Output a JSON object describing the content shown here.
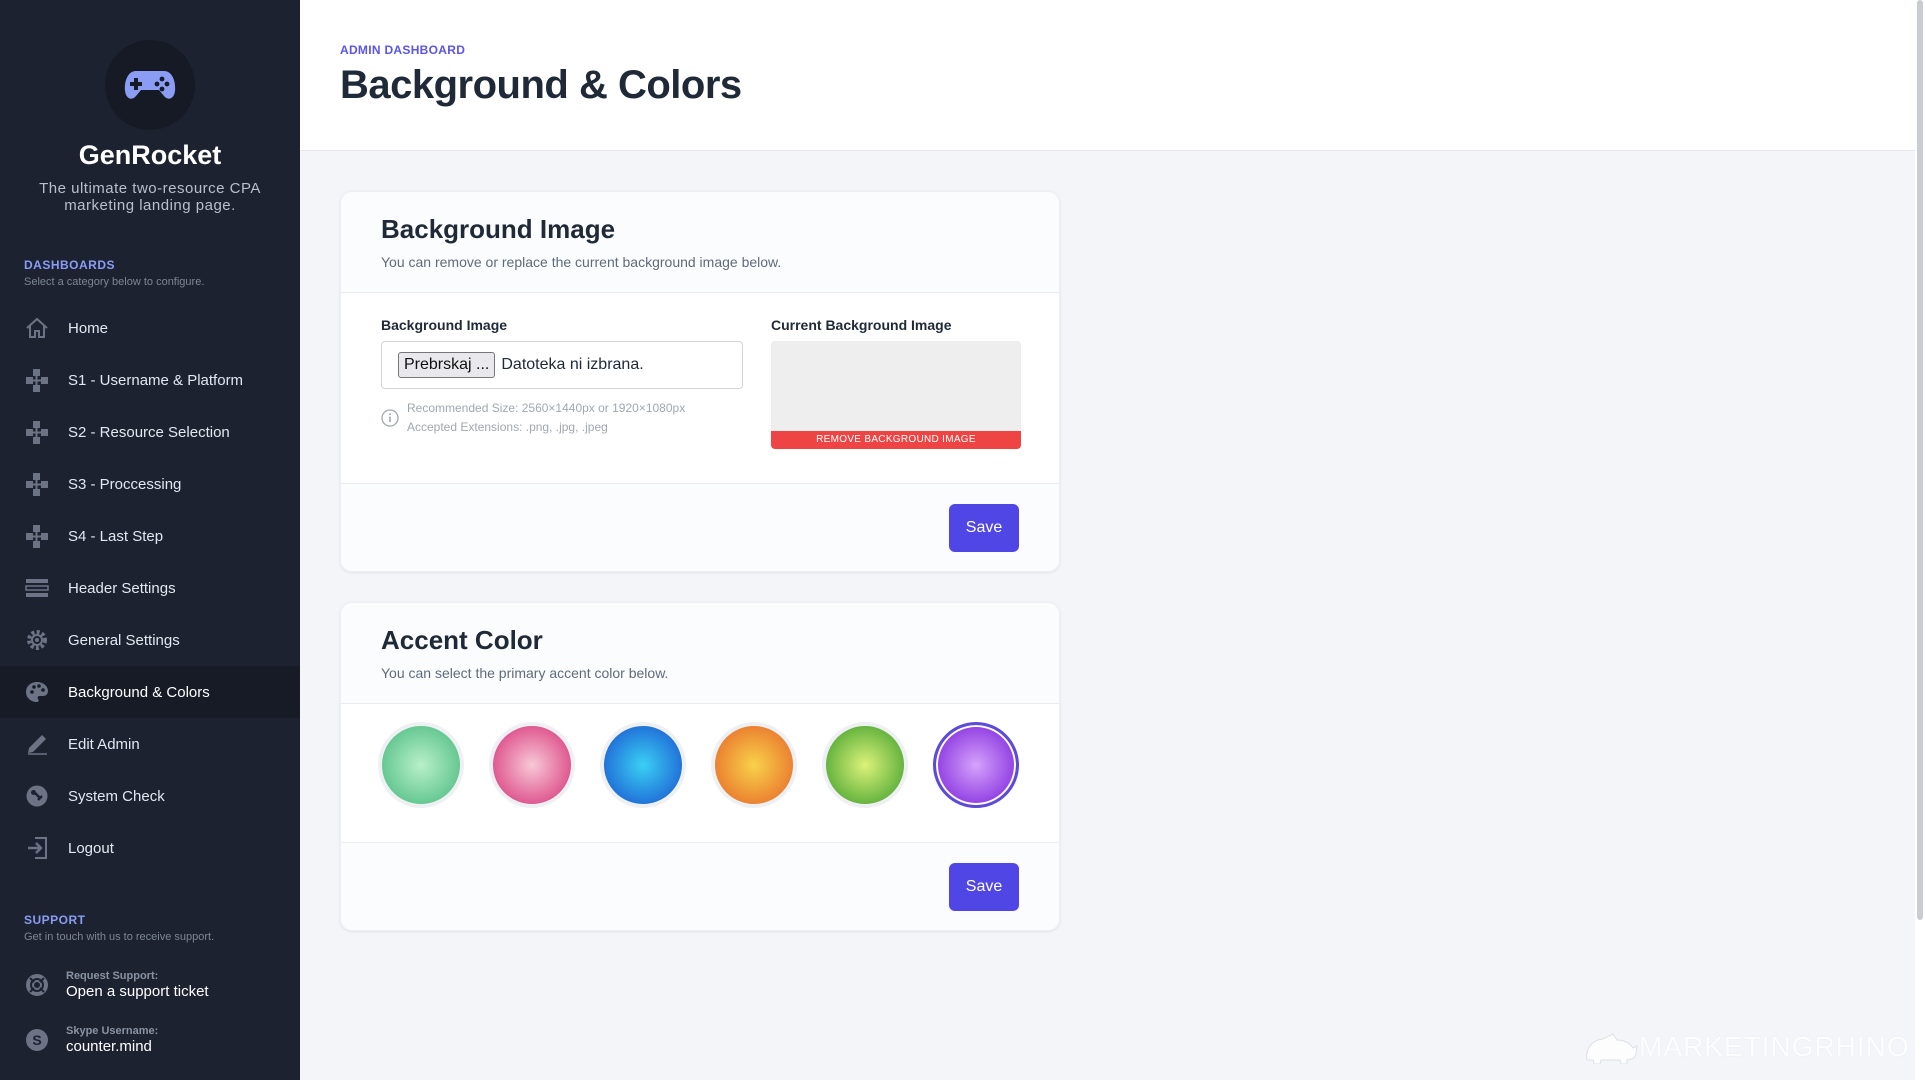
{
  "sidebar": {
    "brand": "GenRocket",
    "tagline": "The ultimate two-resource CPA marketing landing page.",
    "dashboards_title": "DASHBOARDS",
    "dashboards_sub": "Select a category below to configure.",
    "items": [
      {
        "label": "Home",
        "icon": "home-icon"
      },
      {
        "label": "S1 - Username & Platform",
        "icon": "nodes-icon"
      },
      {
        "label": "S2 - Resource Selection",
        "icon": "nodes-icon"
      },
      {
        "label": "S3 - Proccessing",
        "icon": "nodes-icon"
      },
      {
        "label": "S4 - Last Step",
        "icon": "nodes-icon"
      },
      {
        "label": "Header Settings",
        "icon": "header-icon"
      },
      {
        "label": "General Settings",
        "icon": "gear-icon"
      },
      {
        "label": "Background & Colors",
        "icon": "palette-icon",
        "active": true
      },
      {
        "label": "Edit Admin",
        "icon": "pencil-icon"
      },
      {
        "label": "System Check",
        "icon": "wrench-icon"
      },
      {
        "label": "Logout",
        "icon": "logout-icon"
      }
    ],
    "support_title": "SUPPORT",
    "support_sub": "Get in touch with us to receive support.",
    "support_ticket_small": "Request Support:",
    "support_ticket_big": "Open a support ticket",
    "skype_small": "Skype Username:",
    "skype_big": "counter.mind"
  },
  "header": {
    "breadcrumb": "ADMIN DASHBOARD",
    "title": "Background & Colors"
  },
  "background_card": {
    "title": "Background Image",
    "subtitle": "You can remove or replace the current background image below.",
    "field_label": "Background Image",
    "file_button": "Prebrskaj ...",
    "file_status": "Datoteka ni izbrana.",
    "hint_line1": "Recommended Size: 2560×1440px or 1920×1080px",
    "hint_line2": "Accepted Extensions: .png, .jpg, .jpeg",
    "current_label": "Current Background Image",
    "remove_label": "REMOVE BACKGROUND IMAGE",
    "save_label": "Save"
  },
  "accent_card": {
    "title": "Accent Color",
    "subtitle": "You can select the primary accent color below.",
    "swatches": [
      {
        "name": "green",
        "inner": "#b9f0c9",
        "outer": "#5ec48c"
      },
      {
        "name": "pink",
        "inner": "#f7c9d6",
        "outer": "#dd4e8a"
      },
      {
        "name": "blue",
        "inner": "#3ad0f5",
        "outer": "#1f6ad6"
      },
      {
        "name": "orange",
        "inner": "#f8d24a",
        "outer": "#ea7a2f"
      },
      {
        "name": "lime",
        "inner": "#dcf27a",
        "outer": "#5aae3a"
      },
      {
        "name": "purple",
        "inner": "#d6a2fb",
        "outer": "#8a36e0",
        "selected": true
      }
    ],
    "save_label": "Save"
  },
  "watermark": "MARKETINGRHINO",
  "colors": {
    "sidebar_bg": "#1c2230",
    "accent": "#4f46e5",
    "danger": "#ef4444"
  }
}
